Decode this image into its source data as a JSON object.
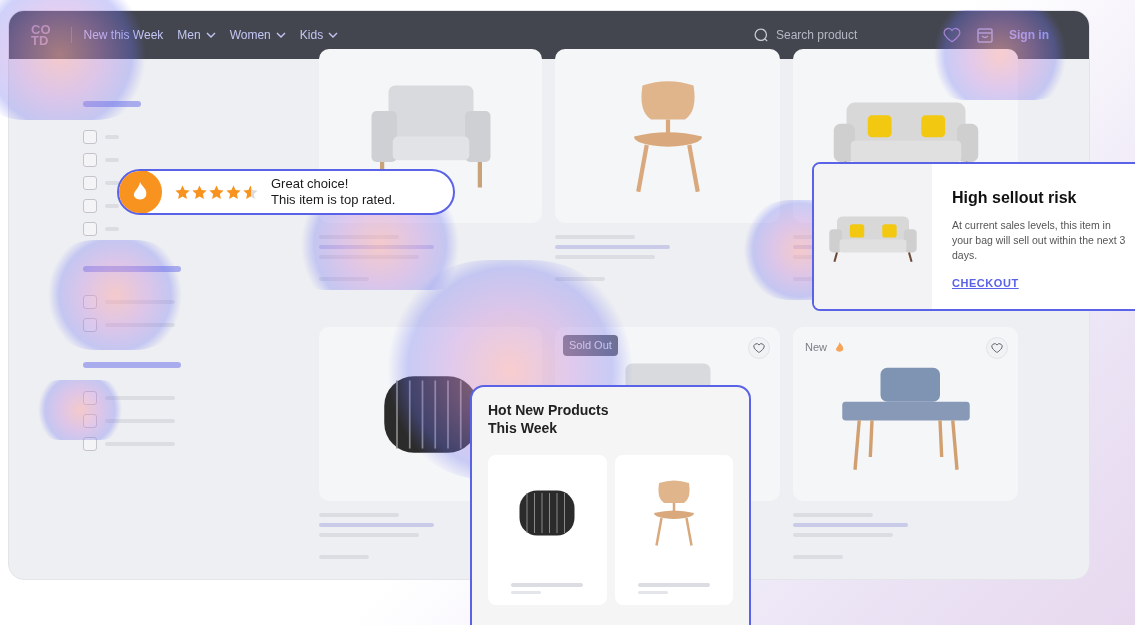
{
  "nav": {
    "logo_lines": [
      "CO",
      "TD"
    ],
    "items": [
      {
        "label": "New this Week",
        "dropdown": false
      },
      {
        "label": "Men",
        "dropdown": true
      },
      {
        "label": "Women",
        "dropdown": true
      },
      {
        "label": "Kids",
        "dropdown": true
      }
    ],
    "search": {
      "placeholder": "Search product"
    },
    "sign_in": "Sign in"
  },
  "sidebar": {
    "groups": [
      {
        "checkboxes": [
          {
            "checked": false
          },
          {
            "checked": false
          },
          {
            "checked": false
          },
          {
            "checked": false
          },
          {
            "checked": false
          }
        ]
      },
      {
        "checkboxes": [
          {
            "checked": false
          },
          {
            "checked": false
          }
        ]
      },
      {
        "checkboxes": [
          {
            "checked": false
          },
          {
            "checked": false
          },
          {
            "checked": false
          }
        ]
      }
    ]
  },
  "products": [
    {
      "kind": "armchair",
      "heart": false
    },
    {
      "kind": "chair",
      "heart": false
    },
    {
      "kind": "sofa",
      "heart": false
    },
    {
      "kind": "lamp",
      "heart": false
    },
    {
      "kind": "armchair",
      "heart": true,
      "badge": "Sold Out"
    },
    {
      "kind": "bench",
      "heart": true,
      "tag": "New"
    }
  ],
  "rating_toast": {
    "stars": 4.5,
    "title": "Great choice!",
    "text": "This item is top rated."
  },
  "sellout_card": {
    "kind": "sofa",
    "title": "High sellout risk",
    "text": "At current sales levels, this item in your bag will sell out within the next 3 days.",
    "link": "CHECKOUT"
  },
  "hot_card": {
    "title": "Hot New Products This Week",
    "products": [
      {
        "kind": "lamp"
      },
      {
        "kind": "chair"
      }
    ]
  }
}
